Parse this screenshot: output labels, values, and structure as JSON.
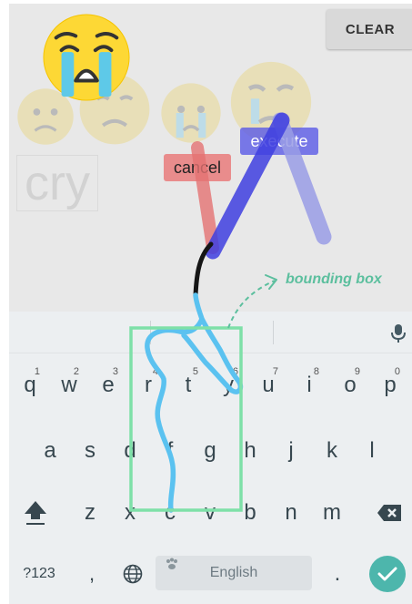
{
  "toolbar": {
    "clear_label": "CLEAR"
  },
  "canvas": {
    "ghost_text": "cry",
    "icons": {
      "big": "crying-face-emoji",
      "ghosts": [
        "sad-face-emoji",
        "sad-face-emoji",
        "crying-face-emoji",
        "sad-face-emoji"
      ]
    },
    "gestures": {
      "cancel_label": "cancel",
      "execute_label": "execute",
      "bbox_label": "bounding box"
    },
    "colors": {
      "cancel": "#e57373",
      "execute": "#3f3fe0",
      "stroke": "#5bc2f0",
      "bbox": "#7ee0a8",
      "annotation": "#5cbf9e"
    }
  },
  "keyboard": {
    "row1": [
      {
        "ch": "q",
        "hint": "1"
      },
      {
        "ch": "w",
        "hint": "2"
      },
      {
        "ch": "e",
        "hint": "3"
      },
      {
        "ch": "r",
        "hint": "4"
      },
      {
        "ch": "t",
        "hint": "5"
      },
      {
        "ch": "y",
        "hint": "6"
      },
      {
        "ch": "u",
        "hint": "7"
      },
      {
        "ch": "i",
        "hint": "8"
      },
      {
        "ch": "o",
        "hint": "9"
      },
      {
        "ch": "p",
        "hint": "0"
      }
    ],
    "row2": [
      "a",
      "s",
      "d",
      "f",
      "g",
      "h",
      "j",
      "k",
      "l"
    ],
    "row3": [
      "z",
      "x",
      "c",
      "v",
      "b",
      "n",
      "m"
    ],
    "symbols_label": "?123",
    "comma": ",",
    "period": ".",
    "space_label": "English",
    "mic_icon": "microphone-icon",
    "shift_icon": "shift-icon",
    "backspace_icon": "backspace-icon",
    "globe_icon": "globe-icon",
    "enter_icon": "checkmark-icon",
    "accent": "#4db6ac"
  }
}
